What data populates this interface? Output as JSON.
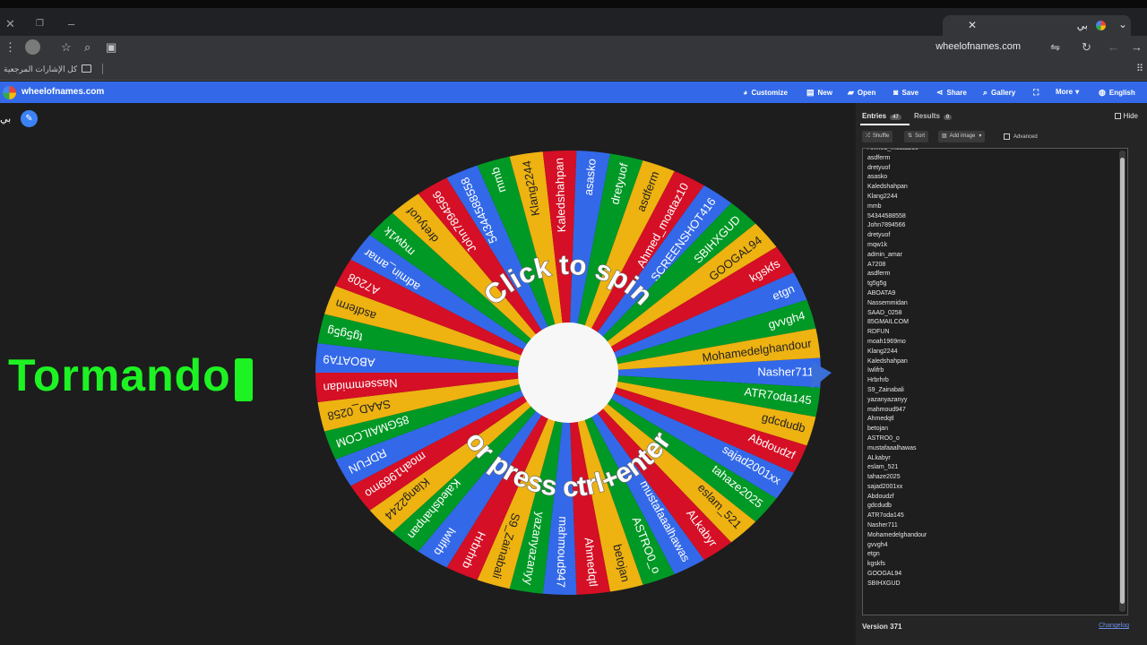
{
  "browser": {
    "tab_title": "بي",
    "url": "wheelofnames.com",
    "bookmarks_label": "كل الإشارات المرجعية",
    "icons": {
      "close": "close-icon",
      "restore": "restore-icon",
      "minimize": "minimize-icon",
      "new_tab": "plus-icon",
      "menu": "kebab-icon"
    }
  },
  "appbar": {
    "brand": "wheelofnames.com",
    "items": [
      "Customize",
      "New",
      "Open",
      "Save",
      "Share",
      "Gallery",
      "",
      "More",
      "English"
    ],
    "icons": [
      "palette-icon",
      "file-icon",
      "folder-icon",
      "save-icon",
      "share-icon",
      "search-icon",
      "fullscreen-icon",
      "chevron-down-icon",
      "globe-icon"
    ]
  },
  "wheel": {
    "title": "بي",
    "overlay_text": "Tormando",
    "center_text_top": "Click to spin",
    "center_text_bottom": "or press ctrl+enter",
    "colors": [
      "#3369e8",
      "#009925",
      "#eeb211",
      "#d50f25"
    ],
    "slice_labels": [
      "Nasher711",
      "ATR7oda145",
      "gdcdudb",
      "Abdoudzf",
      "sajad2001xx",
      "tahaze2025",
      "eslam_521",
      "ALkabyr",
      "mustafaaalhawas",
      "ASTRO0_o",
      "betojan",
      "Ahmedqtl",
      "mahmoud947",
      "yazanyazanyy",
      "S9_Zainabali",
      "Hrbrhrb",
      "Iwlifrb",
      "Kaledshahpan",
      "Klang2244",
      "moah1969mo",
      "RDFUN",
      "85GMAILCOM",
      "SAAD_0258",
      "Nassemmidan",
      "ABOATA9",
      "tg5g5g",
      "asdferm",
      "A7208",
      "admin_amar",
      "mqw1k",
      "dretyuof",
      "John7894566",
      "54344588558",
      "mmb",
      "Klang2244",
      "Kaledshahpan",
      "asasko",
      "dretyuof",
      "asdferm",
      "Ahmed_moataz10",
      "SCREENSHOT416",
      "SBIHXGUD",
      "GOOGAL94",
      "kgskfs",
      "etgn",
      "gvvgh4",
      "Mohamedelghandour"
    ]
  },
  "panel": {
    "tab_entries": "Entries",
    "entries_count": "47",
    "tab_results": "Results",
    "results_count": "0",
    "hide_label": "Hide",
    "shuffle_label": "Shuffle",
    "sort_label": "Sort",
    "add_image_label": "Add image",
    "advanced_label": "Advanced",
    "version": "Version 371",
    "changelog": "Changelog",
    "entries": [
      "Ahmed_moataz10",
      "asdferm",
      "dretyuof",
      "asasko",
      "Kaledshahpan",
      "Klang2244",
      "mmb",
      "54344588558",
      "John7894566",
      "dretyuof",
      "mqw1k",
      "admin_amar",
      "A7208",
      "asdferm",
      "tg5g5g",
      "ABOATA9",
      "Nassemmidan",
      "SAAD_0258",
      "85GMAILCOM",
      "RDFUN",
      "moah1969mo",
      "Klang2244",
      "Kaledshahpan",
      "Iwlifrb",
      "Hrbrhrb",
      "S9_Zainabali",
      "yazanyazanyy",
      "mahmoud947",
      "Ahmedqtl",
      "betojan",
      "ASTRO0_o",
      "mustafaaalhawas",
      "ALkabyr",
      "eslam_521",
      "tahaze2025",
      "sajad2001xx",
      "Abdoudzf",
      "gdcdudb",
      "ATR7oda145",
      "Nasher711",
      "Mohamedelghandour",
      "gvvgh4",
      "etgn",
      "kgskfs",
      "GOOGAL94",
      "SBIHXGUD"
    ]
  }
}
